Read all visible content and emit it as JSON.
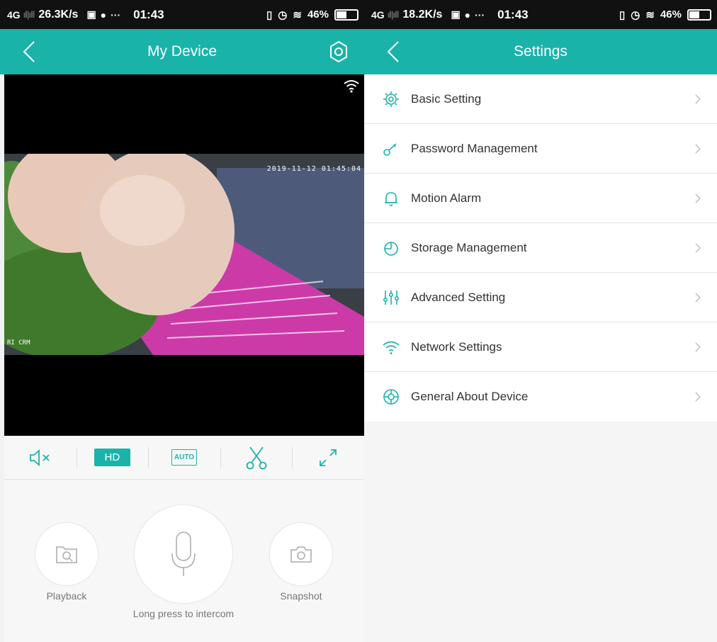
{
  "left": {
    "status": {
      "network": "4G",
      "speed": "26.3K/s",
      "time": "01:43",
      "battery": "46%"
    },
    "title": "My Device",
    "video": {
      "timestamp": "2019-11-12 01:45:04",
      "brand": "RI CRM"
    },
    "controls": {
      "hd": "HD",
      "auto": "AUTO"
    },
    "actions": {
      "playback": "Playback",
      "intercom": "Long press to intercom",
      "snapshot": "Snapshot"
    }
  },
  "right": {
    "status": {
      "network": "4G",
      "speed": "18.2K/s",
      "time": "01:43",
      "battery": "46%"
    },
    "title": "Settings",
    "items": [
      {
        "label": "Basic Setting",
        "icon": "gear-icon"
      },
      {
        "label": "Password Management",
        "icon": "key-icon"
      },
      {
        "label": "Motion Alarm",
        "icon": "bell-icon"
      },
      {
        "label": "Storage Management",
        "icon": "pie-icon"
      },
      {
        "label": "Advanced Setting",
        "icon": "sliders-icon"
      },
      {
        "label": "Network Settings",
        "icon": "wifi-icon"
      },
      {
        "label": "General About Device",
        "icon": "lifebuoy-icon"
      }
    ]
  },
  "colors": {
    "accent": "#1ab3aa",
    "statusbar": "#111111",
    "text": "#333333"
  },
  "battery_level": 0.46
}
